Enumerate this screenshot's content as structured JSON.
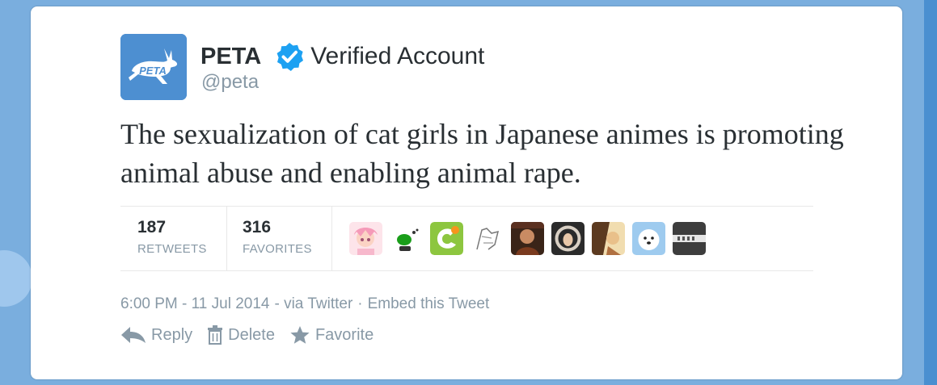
{
  "user": {
    "display_name": "PETA",
    "verified_label": "Verified Account",
    "handle": "@peta",
    "avatar_text": "PETA"
  },
  "tweet": {
    "text": "The sexualization of cat girls in Japanese animes is promoting animal abuse and enabling animal rape."
  },
  "stats": {
    "retweets": {
      "count": "187",
      "label": "RETWEETS"
    },
    "favorites": {
      "count": "316",
      "label": "FAVORITES"
    }
  },
  "meta": {
    "timestamp": "6:00 PM - 11 Jul 2014",
    "via": "- via Twitter",
    "separator": "·",
    "embed": "Embed this Tweet"
  },
  "actions": {
    "reply": "Reply",
    "delete": "Delete",
    "favorite": "Favorite"
  },
  "colors": {
    "background": "#7aaede",
    "verified_badge": "#1da1f2",
    "avatar": "#4d8fd1",
    "muted_text": "#8899a6"
  }
}
